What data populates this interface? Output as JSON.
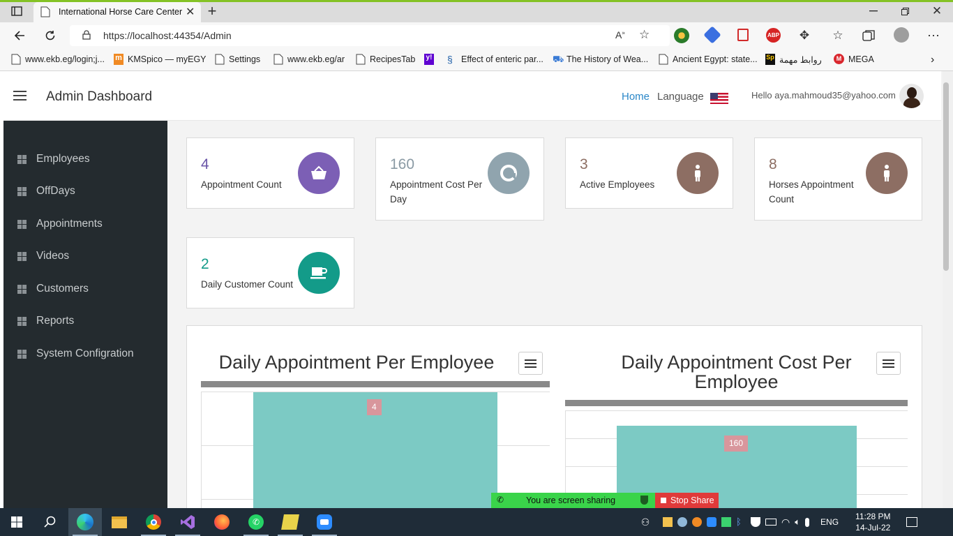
{
  "browser": {
    "tab_title": "International Horse Care Center",
    "url": "https://localhost:44354/Admin",
    "bookmarks": [
      "www.ekb.eg/login;j...",
      "KMSpico — myEGY",
      "Settings",
      "www.ekb.eg/ar",
      "RecipesTab",
      "Effect of enteric par...",
      "The History of Wea...",
      "Ancient Egypt: state...",
      "روابط مهمة",
      "MEGA"
    ]
  },
  "header": {
    "title": "Admin Dashboard",
    "home": "Home",
    "language": "Language",
    "greeting": "Hello aya.mahmoud35@yahoo.com"
  },
  "sidebar": {
    "items": [
      "Employees",
      "OffDays",
      "Appointments",
      "Videos",
      "Customers",
      "Reports",
      "System Configration"
    ]
  },
  "cards": [
    {
      "value": "4",
      "label": "Appointment Count",
      "color": "#7c5fb5",
      "icon": "basket-icon"
    },
    {
      "value": "160",
      "label": "Appointment Cost Per Day",
      "color": "#90a4ae",
      "icon": "pie-icon"
    },
    {
      "value": "3",
      "label": "Active Employees",
      "color": "#8d6e63",
      "icon": "person-icon"
    },
    {
      "value": "8",
      "label": "Horses Appointment Count",
      "color": "#8d6e63",
      "icon": "person-icon"
    },
    {
      "value": "2",
      "label": "Daily Customer Count",
      "color": "#139b89",
      "icon": "cup-icon"
    }
  ],
  "chart_data": [
    {
      "type": "bar",
      "title": "Daily Appointment Per Employee",
      "series": [
        {
          "values": [
            4
          ]
        }
      ],
      "data_labels": [
        "4"
      ]
    },
    {
      "type": "bar",
      "title": "Daily Appointment Cost Per Employee",
      "series": [
        {
          "values": [
            160
          ]
        }
      ],
      "data_labels": [
        "160"
      ]
    }
  ],
  "share": {
    "status": "You are screen sharing",
    "stop": "Stop Share"
  },
  "tray": {
    "lang": "ENG",
    "time": "11:28 PM",
    "date": "14-Jul-22"
  }
}
